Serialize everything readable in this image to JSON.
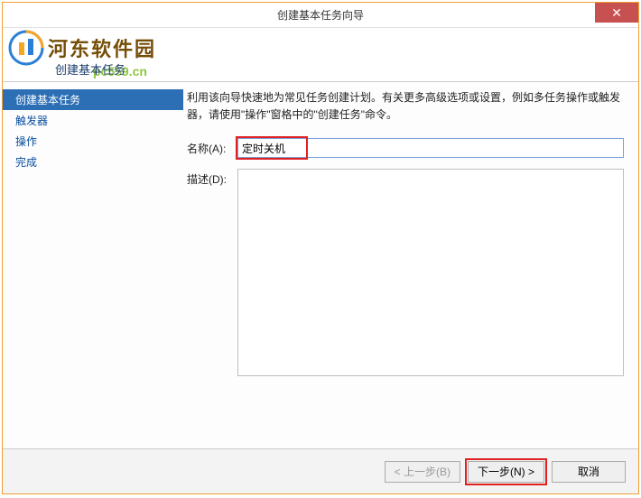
{
  "window": {
    "title": "创建基本任务向导",
    "close_label": "✕"
  },
  "watermark": {
    "brand": "河东软件园",
    "url": "pc559.cn"
  },
  "header": {
    "subtitle": "创建基本任务"
  },
  "sidebar": {
    "items": [
      {
        "label": "创建基本任务",
        "active": true
      },
      {
        "label": "触发器",
        "active": false
      },
      {
        "label": "操作",
        "active": false
      },
      {
        "label": "完成",
        "active": false
      }
    ]
  },
  "content": {
    "intro": "利用该向导快速地为常见任务创建计划。有关更多高级选项或设置，例如多任务操作或触发器，请使用\"操作\"窗格中的\"创建任务\"命令。",
    "name_label": "名称(A):",
    "name_value": "定时关机",
    "desc_label": "描述(D):",
    "desc_value": ""
  },
  "footer": {
    "back_label": "< 上一步(B)",
    "next_label": "下一步(N) >",
    "cancel_label": "取消"
  }
}
